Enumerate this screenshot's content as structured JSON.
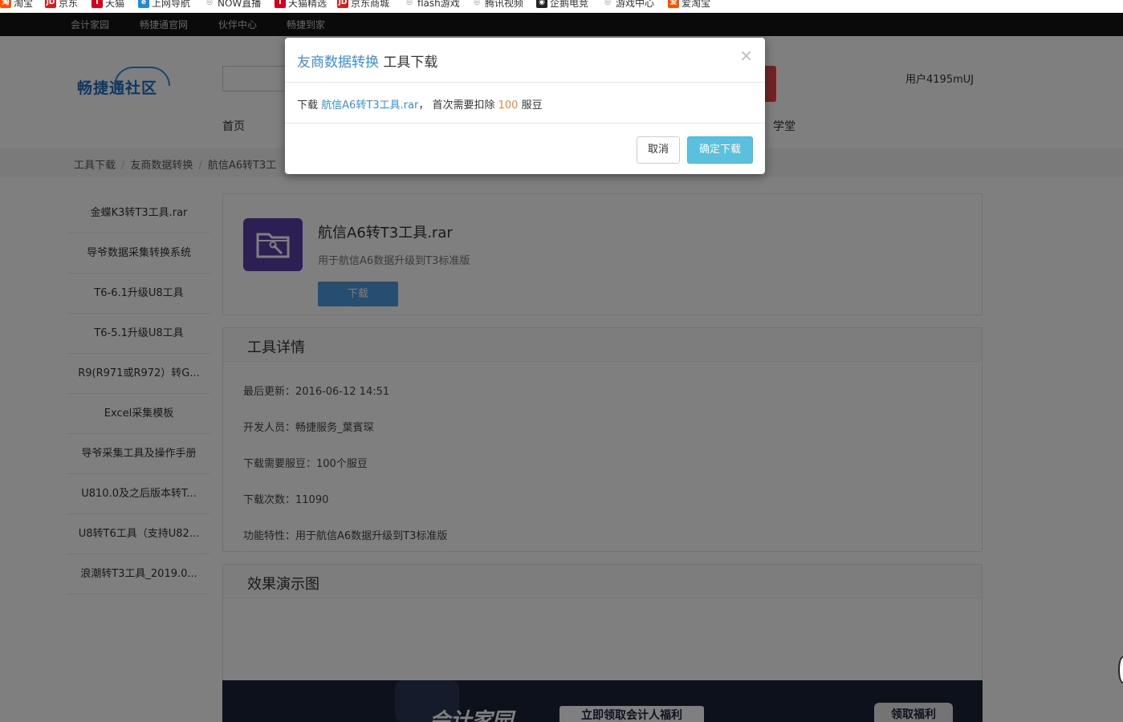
{
  "bookmarks": [
    {
      "label": "淘宝",
      "icon": "taobao-icon",
      "color": "#ff5000",
      "glyph": "淘"
    },
    {
      "label": "京东",
      "icon": "jd-icon",
      "color": "#d71c1c",
      "glyph": "JD"
    },
    {
      "label": "天猫",
      "icon": "tmall-icon",
      "color": "#d6001c",
      "glyph": "T"
    },
    {
      "label": "上网导航",
      "icon": "ie-icon",
      "color": "#1e88e5",
      "glyph": "e"
    },
    {
      "label": "NOW直播",
      "icon": "globe-icon",
      "color": "#888888",
      "glyph": "◎"
    },
    {
      "label": "天猫精选",
      "icon": "tmall-icon",
      "color": "#d6001c",
      "glyph": "T"
    },
    {
      "label": "京东商城",
      "icon": "jd-icon",
      "color": "#d71c1c",
      "glyph": "JD"
    },
    {
      "label": "flash游戏",
      "icon": "globe-icon",
      "color": "#888888",
      "glyph": "◎"
    },
    {
      "label": "腾讯视频",
      "icon": "globe-icon",
      "color": "#888888",
      "glyph": "◎"
    },
    {
      "label": "企鹅电竞",
      "icon": "penguin-icon",
      "color": "#222222",
      "glyph": "◉"
    },
    {
      "label": "游戏中心",
      "icon": "globe-icon",
      "color": "#888888",
      "glyph": "◎"
    },
    {
      "label": "爱淘宝",
      "icon": "aitaobao-icon",
      "color": "#ff5000",
      "glyph": "爱"
    }
  ],
  "topnav": [
    "会计家园",
    "畅捷通官网",
    "伙伴中心",
    "畅捷到家"
  ],
  "header": {
    "logo_text": "畅捷通社区",
    "user": "用户4195mUJ",
    "nav_home": "首页",
    "nav_school": "学堂"
  },
  "breadcrumb": [
    "工具下载",
    "友商数据转换",
    "航信A6转T3工"
  ],
  "sidebar": [
    "金蝶K3转T3工具.rar",
    "导爷数据采集转换系统",
    "T6-6.1升级U8工具",
    "T6-5.1升级U8工具",
    "R9(R971或R972）转G...",
    "Excel采集模板",
    "导爷采集工具及操作手册",
    "U810.0及之后版本转T...",
    "U8转T6工具（支持U82...",
    "浪潮转T3工具_2019.0..."
  ],
  "tool": {
    "title": "航信A6转T3工具.rar",
    "desc": "用于航信A6数据升级到T3标准版",
    "download": "下载"
  },
  "detail": {
    "heading": "工具详情",
    "rows": [
      "最后更新：2016-06-12 14:51",
      "开发人员：畅捷服务_葉賓琛",
      "下载需要服豆：100个服豆",
      "下载次数：11090",
      "功能特性：用于航信A6数据升级到T3标准版"
    ]
  },
  "demo": {
    "heading": "效果演示图"
  },
  "banner": {
    "title": "会计家园",
    "slogan": "立即领取会计人福利",
    "cta": "领取福利"
  },
  "modal": {
    "title_link": "友商数据转换",
    "title_rest": "工具下载",
    "close": "×",
    "body_prefix": "下载",
    "body_file": "航信A6转T3工具.rar",
    "body_mid": "，  首次需要扣除",
    "body_amount": "100",
    "body_suffix": "服豆",
    "cancel": "取消",
    "confirm": "确定下载"
  }
}
